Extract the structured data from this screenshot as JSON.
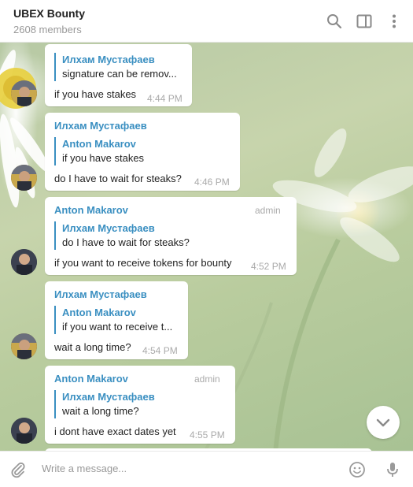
{
  "header": {
    "title": "UBEX Bounty",
    "members": "2608 members"
  },
  "messages": [
    {
      "sender": "",
      "admin": "",
      "reply_name": "Илхам Мустафаев",
      "reply_text": "signature can be remov...",
      "text": "if you have stakes",
      "time": "4:44 PM"
    },
    {
      "sender": "Илхам Мустафаев",
      "admin": "",
      "reply_name": "Anton Makarov",
      "reply_text": "if you have stakes",
      "text": "do I have to wait for steaks?",
      "time": "4:46 PM"
    },
    {
      "sender": "Anton Makarov",
      "admin": "admin",
      "reply_name": "Илхам Мустафаев",
      "reply_text": "do I have to wait for steaks?",
      "text": "if you want to receive tokens for bounty",
      "time": "4:52 PM"
    },
    {
      "sender": "Илхам Мустафаев",
      "admin": "",
      "reply_name": "Anton Makarov",
      "reply_text": "if you want to receive t...",
      "text": "wait a long time?",
      "time": "4:54 PM"
    },
    {
      "sender": "Anton Makarov",
      "admin": "admin",
      "reply_name": "Илхам Мустафаев",
      "reply_text": "wait a long time?",
      "text": "i dont have exact dates yet",
      "time": "4:55 PM"
    }
  ],
  "composer": {
    "placeholder": "Write a message..."
  },
  "icons": {
    "search": "search-icon",
    "sidebar": "sidebar-toggle-icon",
    "menu": "more-vertical-icon",
    "attach": "paperclip-icon",
    "emoji": "emoji-icon",
    "mic": "microphone-icon",
    "scroll": "chevron-down-icon"
  },
  "colors": {
    "accent": "#3a8fc1",
    "meta_text": "#aaaaaa"
  }
}
